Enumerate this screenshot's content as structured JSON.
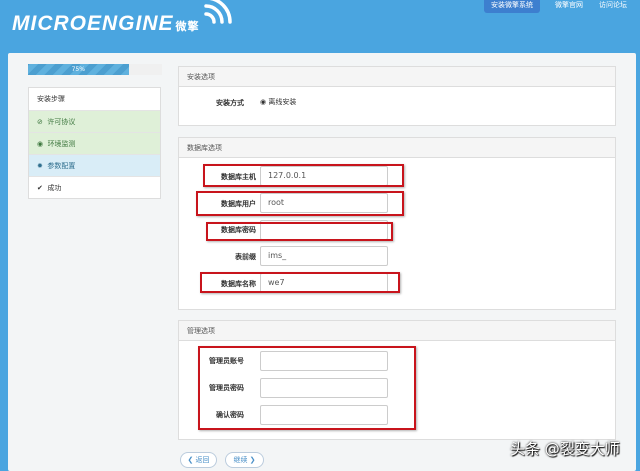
{
  "header": {
    "logo": "MICROENGINE",
    "logo_cn": "微擎",
    "nav": [
      "安装微擎系统",
      "微擎官网",
      "访问论坛"
    ]
  },
  "progress": {
    "percent": 75,
    "label": "75%"
  },
  "steps": {
    "title": "安装步骤",
    "items": [
      {
        "label": "许可协议",
        "icon": "ban-icon",
        "state": "done"
      },
      {
        "label": "环境监测",
        "icon": "eye-icon",
        "state": "done"
      },
      {
        "label": "参数配置",
        "icon": "gear-icon",
        "state": "current"
      },
      {
        "label": "成功",
        "icon": "check-icon",
        "state": "pending"
      }
    ]
  },
  "install": {
    "title": "安装选项",
    "method_label": "安装方式",
    "method_value": "离线安装"
  },
  "database": {
    "title": "数据库选项",
    "host_label": "数据库主机",
    "host": "127.0.0.1",
    "user_label": "数据库用户",
    "user": "root",
    "password_label": "数据库密码",
    "password": "",
    "prefix_label": "表前缀",
    "prefix": "ims_",
    "name_label": "数据库名称",
    "name": "we7"
  },
  "admin": {
    "title": "管理选项",
    "account_label": "管理员账号",
    "password_label": "管理员密码",
    "confirm_label": "确认密码"
  },
  "buttons": {
    "back": "❮ 返回",
    "next": "继续 ❯"
  },
  "watermark": "头条 @裂变大师"
}
